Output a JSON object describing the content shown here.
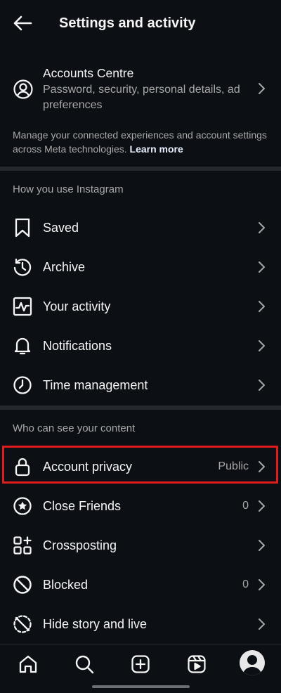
{
  "header": {
    "title": "Settings and activity"
  },
  "accounts_centre": {
    "title": "Accounts Centre",
    "subtitle": "Password, security, personal details, ad preferences"
  },
  "meta_note": {
    "text": "Manage your connected experiences and account settings across Meta technologies.",
    "link": "Learn more"
  },
  "section_usage": {
    "title": "How you use Instagram",
    "items": [
      {
        "label": "Saved",
        "icon": "bookmark-icon"
      },
      {
        "label": "Archive",
        "icon": "archive-icon"
      },
      {
        "label": "Your activity",
        "icon": "activity-icon"
      },
      {
        "label": "Notifications",
        "icon": "bell-icon"
      },
      {
        "label": "Time management",
        "icon": "clock-icon"
      }
    ]
  },
  "section_visibility": {
    "title": "Who can see your content",
    "items": [
      {
        "label": "Account privacy",
        "value": "Public",
        "icon": "lock-icon"
      },
      {
        "label": "Close Friends",
        "value": "0",
        "icon": "star-circle-icon"
      },
      {
        "label": "Crossposting",
        "value": "",
        "icon": "crossposting-icon"
      },
      {
        "label": "Blocked",
        "value": "0",
        "icon": "blocked-icon"
      },
      {
        "label": "Hide story and live",
        "value": "",
        "icon": "hide-story-icon"
      }
    ]
  },
  "bottom_nav": {
    "items": [
      "home-icon",
      "search-icon",
      "create-icon",
      "reels-icon",
      "profile-avatar"
    ]
  },
  "colors": {
    "background": "#0c1014",
    "text": "#f5f5f5",
    "secondary_text": "#a8a8a8",
    "highlight": "#e01b1b"
  }
}
